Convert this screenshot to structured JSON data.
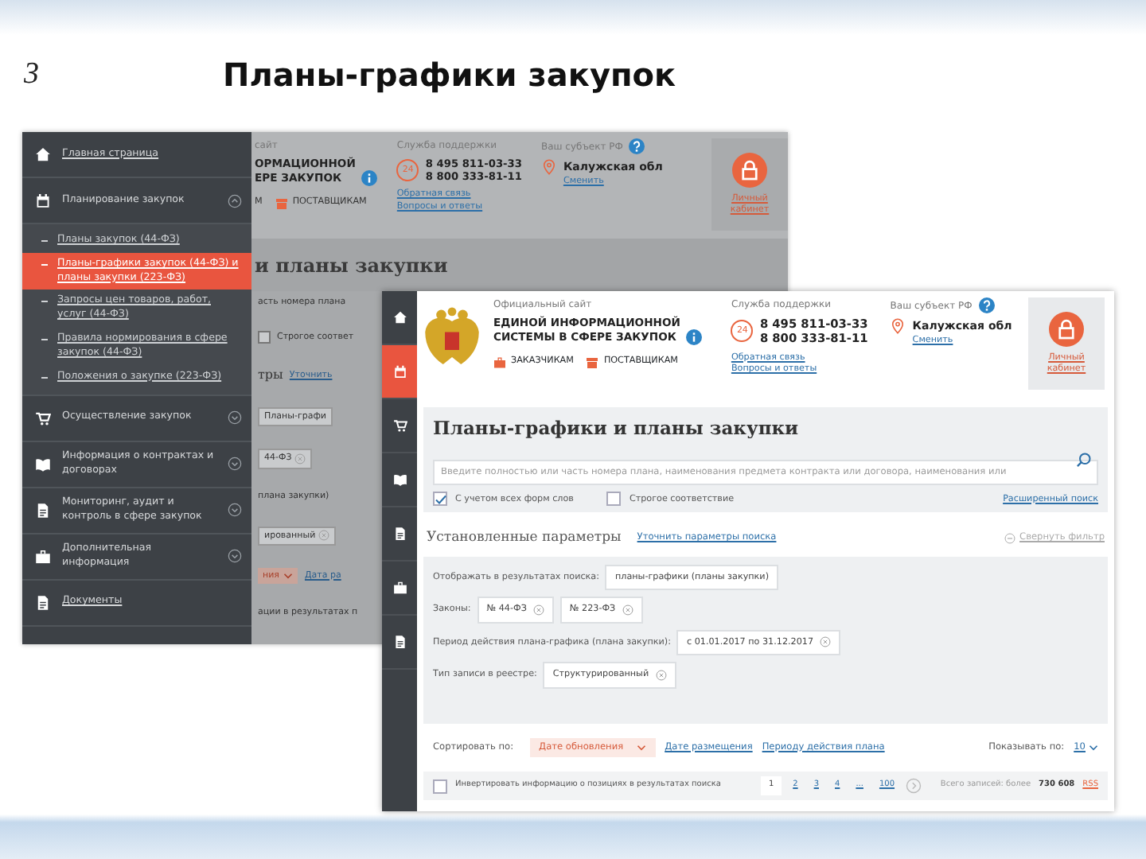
{
  "slide": {
    "number": "3",
    "title": "Планы-графики закупок"
  },
  "back_screen": {
    "menu": [
      {
        "label": "Главная страница",
        "kind": "link"
      },
      {
        "label": "Планирование закупок",
        "kind": "section",
        "expanded": true,
        "children": [
          {
            "label": "Планы закупок (44-ФЗ)",
            "selected": false
          },
          {
            "label": "Планы-графики закупок (44-ФЗ) и планы закупки (223-ФЗ)",
            "selected": true
          },
          {
            "label": "Запросы цен товаров, работ, услуг (44-ФЗ)",
            "selected": false
          },
          {
            "label": "Правила нормирования в сфере закупок (44-ФЗ)",
            "selected": false
          },
          {
            "label": "Положения о закупке (223-ФЗ)",
            "selected": false
          }
        ]
      },
      {
        "label": "Осуществление закупок",
        "kind": "section",
        "expanded": false
      },
      {
        "label": "Информация о контрактах и договорах",
        "kind": "section",
        "expanded": false
      },
      {
        "label": "Мониторинг, аудит и контроль в сфере закупок",
        "kind": "section",
        "expanded": false
      },
      {
        "label": "Дополнительная информация",
        "kind": "section",
        "expanded": false
      },
      {
        "label": "Документы",
        "kind": "link"
      }
    ],
    "header": {
      "site_label": "сайт",
      "site_name": [
        "ОРМАЦИОННОЙ",
        "ЕРЕ ЗАКУПОК"
      ],
      "nav": [
        "М",
        "ПОСТАВЩИКАМ"
      ],
      "support_label": "Служба поддержки",
      "support_badge": "24",
      "phones": [
        "8 495 811-03-33",
        "8 800 333-81-11"
      ],
      "support_links": [
        "Обратная связь",
        "Вопросы и ответы"
      ],
      "region_label": "Ваш субъект РФ",
      "region": "Калужская обл",
      "region_link": "Сменить",
      "cabinet": "Личный кабинет"
    },
    "title": "и планы закупки",
    "strip_rows": [
      [
        {
          "text": "асть номера плана",
          "kind": "text"
        }
      ],
      [
        {
          "text": "Строгое соответ",
          "kind": "checkbox",
          "checked": false
        }
      ],
      [
        {
          "text": "тры",
          "kind": "heading"
        },
        {
          "text": "Уточнить",
          "kind": "link"
        }
      ],
      [
        {
          "text": "Планы-графи",
          "kind": "chip",
          "removable": false
        }
      ],
      [
        {
          "text": "44-ФЗ",
          "kind": "chip",
          "removable": true
        }
      ],
      [
        {
          "text": "плана закупки)",
          "kind": "text"
        }
      ],
      [
        {
          "text": "ированный",
          "kind": "chip",
          "removable": true
        }
      ],
      [
        {
          "text": "ния",
          "kind": "select"
        },
        {
          "text": "Дата ра",
          "kind": "link"
        }
      ],
      [
        {
          "text": "ации в результатах п",
          "kind": "text"
        }
      ]
    ]
  },
  "front_screen": {
    "sidebar": [
      {
        "selected": false
      },
      {
        "selected": true
      },
      {
        "selected": false
      },
      {
        "selected": false
      },
      {
        "selected": false
      },
      {
        "selected": false
      },
      {
        "selected": false
      }
    ],
    "header": {
      "site_label": "Официальный сайт",
      "site_name": [
        "ЕДИНОЙ ИНФОРМАЦИОННОЙ",
        "СИСТЕМЫ В СФЕРЕ ЗАКУПОК"
      ],
      "nav": [
        "ЗАКАЗЧИКАМ",
        "ПОСТАВЩИКАМ"
      ],
      "support_label": "Служба поддержки",
      "support_badge": "24",
      "phones": [
        "8 495 811-03-33",
        "8 800 333-81-11"
      ],
      "support_links": [
        "Обратная связь",
        "Вопросы и ответы"
      ],
      "region_label": "Ваш субъект РФ",
      "region": "Калужская обл",
      "region_link": "Сменить",
      "cabinet": "Личный кабинет"
    },
    "search": {
      "title": "Планы-графики и планы закупки",
      "placeholder": "Введите полностью или часть номера плана, наименования предмета контракта или договора, наименования или",
      "options": [
        {
          "label": "С учетом всех форм слов",
          "checked": true
        },
        {
          "label": "Строгое соответствие",
          "checked": false
        }
      ],
      "advanced_link": "Расширенный поиск"
    },
    "params": {
      "title": "Установленные параметры",
      "refine_link": "Уточнить параметры поиска",
      "collapse": "Свернуть фильтр",
      "rows": [
        {
          "label": "Отображать в результатах поиска:",
          "chips": [
            {
              "text": "планы-графики (планы закупки)",
              "removable": false
            }
          ]
        },
        {
          "label": "Законы:",
          "chips": [
            {
              "text": "№ 44-ФЗ",
              "removable": true
            },
            {
              "text": "№ 223-ФЗ",
              "removable": true
            }
          ]
        },
        {
          "label": "Период действия плана-графика (плана закупки):",
          "chips": [
            {
              "text": "с 01.01.2017 по 31.12.2017",
              "removable": true
            }
          ]
        },
        {
          "label": "Тип записи в реестре:",
          "chips": [
            {
              "text": "Структурированный",
              "removable": true
            }
          ]
        }
      ]
    },
    "sort": {
      "label": "Сортировать по:",
      "options": [
        {
          "label": "Дате обновления",
          "selected": true
        },
        {
          "label": "Дате размещения",
          "selected": false
        },
        {
          "label": "Периоду действия плана",
          "selected": false
        }
      ],
      "page_size_label": "Показывать по:",
      "page_size": "10"
    },
    "footer": {
      "invert": {
        "label": "Инвертировать информацию о позициях в результатах поиска",
        "checked": false
      },
      "pages": [
        {
          "label": "1",
          "selected": true
        },
        {
          "label": "2",
          "selected": false
        },
        {
          "label": "3",
          "selected": false
        },
        {
          "label": "4",
          "selected": false
        },
        {
          "label": "...",
          "selected": false
        },
        {
          "label": "100",
          "selected": false
        }
      ],
      "total_label": "Всего записей: более",
      "total": "730 608",
      "rss": "RSS"
    }
  }
}
